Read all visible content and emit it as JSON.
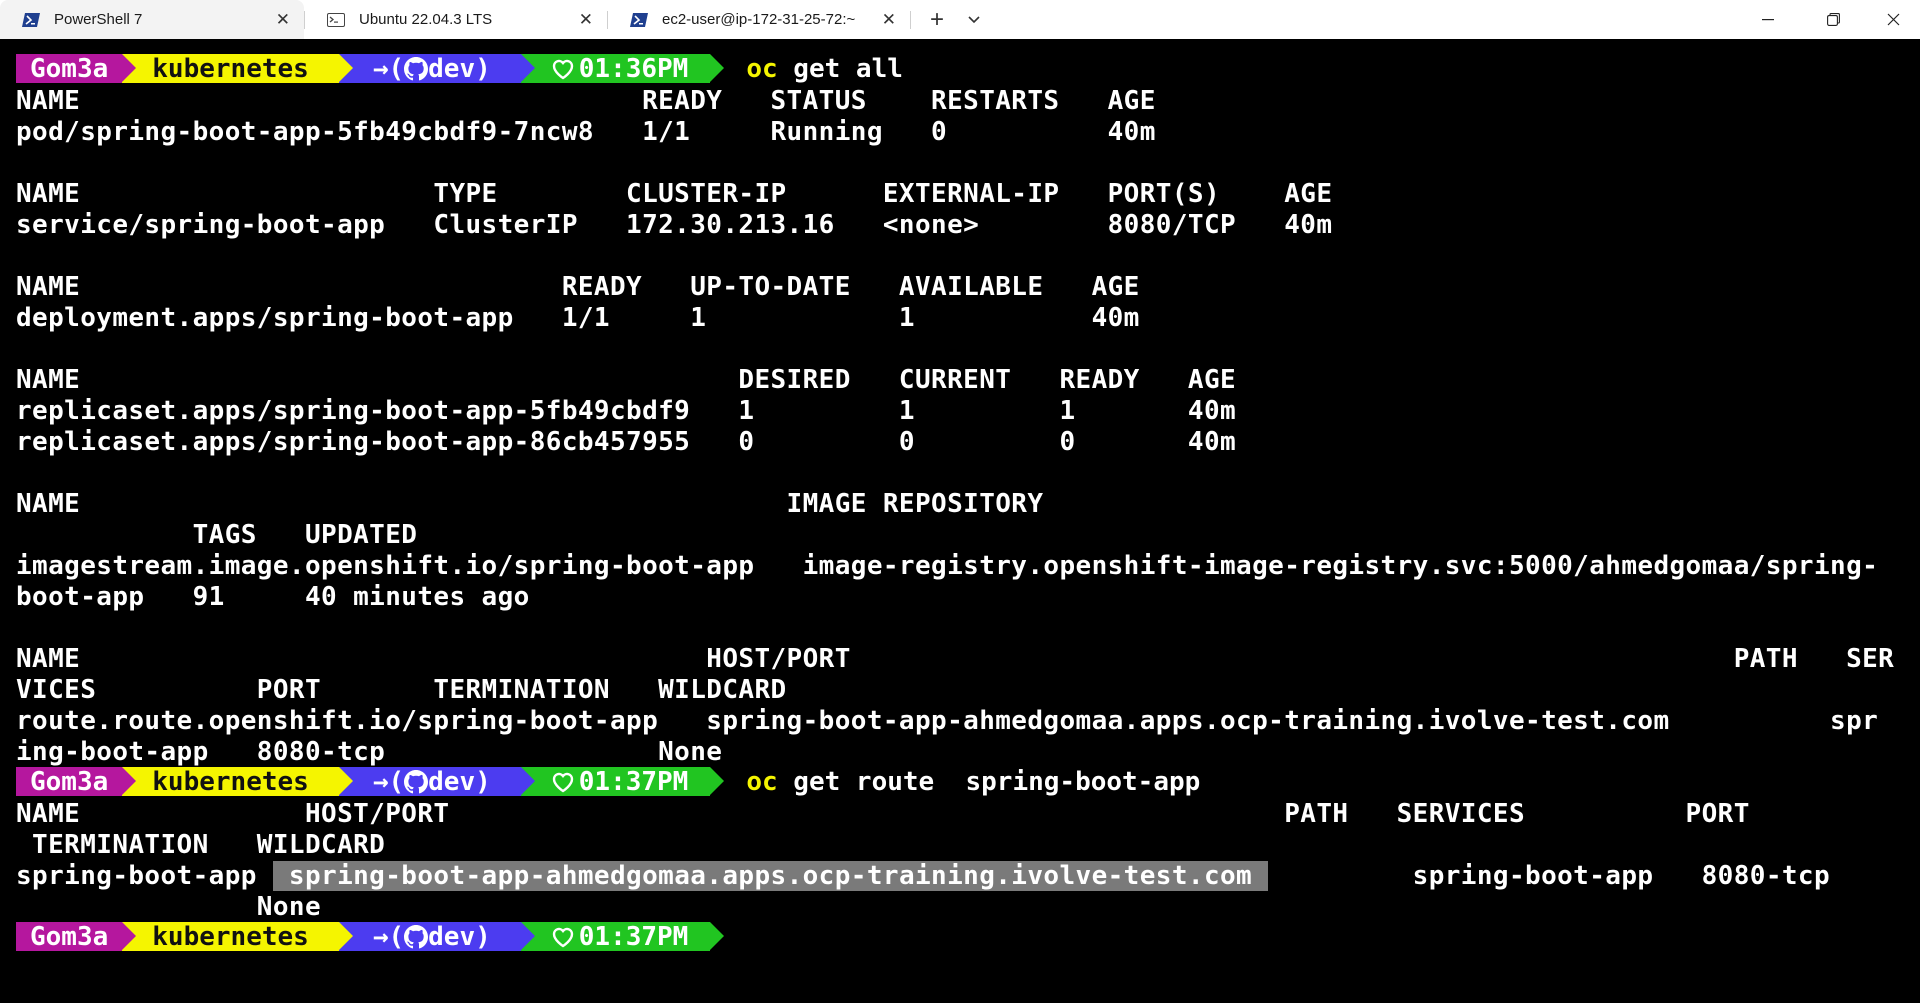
{
  "tabs": [
    {
      "title": "PowerShell 7",
      "icon": "powershell-icon",
      "active": true
    },
    {
      "title": "Ubuntu 22.04.3 LTS",
      "icon": "terminal-icon",
      "active": false
    },
    {
      "title": "ec2-user@ip-172-31-25-72:~",
      "icon": "powershell-icon",
      "active": false
    }
  ],
  "window_controls": {
    "minimize": "—",
    "maximize": "❐",
    "close": "✕",
    "new_tab": "+",
    "dropdown": "⌄"
  },
  "colors": {
    "user_segment": "#b5179e",
    "dir_segment": "#f5f500",
    "git_segment": "#4c3cf0",
    "time_segment": "#21c521",
    "command_verb": "#f5f500"
  },
  "prompts": [
    {
      "user": "Gom3a",
      "dir": "kubernetes",
      "branch": "dev",
      "time": "01:36PM",
      "cmd_verb": "oc",
      "cmd_args": " get all"
    },
    {
      "user": "Gom3a",
      "dir": "kubernetes",
      "branch": "dev",
      "time": "01:37PM",
      "cmd_verb": "oc",
      "cmd_args": " get route  spring-boot-app"
    },
    {
      "user": "Gom3a",
      "dir": "kubernetes",
      "branch": "dev",
      "time": "01:37PM",
      "cmd_verb": "",
      "cmd_args": ""
    }
  ],
  "git_arrow": "→",
  "output1": [
    "NAME                                   READY   STATUS    RESTARTS   AGE",
    "pod/spring-boot-app-5fb49cbdf9-7ncw8   1/1     Running   0          40m",
    "",
    "NAME                      TYPE        CLUSTER-IP      EXTERNAL-IP   PORT(S)    AGE",
    "service/spring-boot-app   ClusterIP   172.30.213.16   <none>        8080/TCP   40m",
    "",
    "NAME                              READY   UP-TO-DATE   AVAILABLE   AGE",
    "deployment.apps/spring-boot-app   1/1     1            1           40m",
    "",
    "NAME                                         DESIRED   CURRENT   READY   AGE",
    "replicaset.apps/spring-boot-app-5fb49cbdf9   1         1         1       40m",
    "replicaset.apps/spring-boot-app-86cb457955   0         0         0       40m",
    "",
    "NAME                                            IMAGE REPOSITORY",
    "           TAGS   UPDATED",
    "imagestream.image.openshift.io/spring-boot-app   image-registry.openshift-image-registry.svc:5000/ahmedgomaa/spring-",
    "boot-app   91     40 minutes ago",
    "",
    "NAME                                       HOST/PORT                                                       PATH   SER",
    "VICES          PORT       TERMINATION   WILDCARD",
    "route.route.openshift.io/spring-boot-app   spring-boot-app-ahmedgomaa.apps.ocp-training.ivolve-test.com          spr",
    "ing-boot-app   8080-tcp                 None"
  ],
  "output2": [
    "NAME              HOST/PORT                                                    PATH   SERVICES          PORT",
    " TERMINATION   WILDCARD",
    "",
    "               None"
  ],
  "route_row": {
    "name": "spring-boot-app ",
    "host": " spring-boot-app-ahmedgomaa.apps.ocp-training.ivolve-test.com ",
    "rest": "         spring-boot-app   8080-tcp"
  }
}
